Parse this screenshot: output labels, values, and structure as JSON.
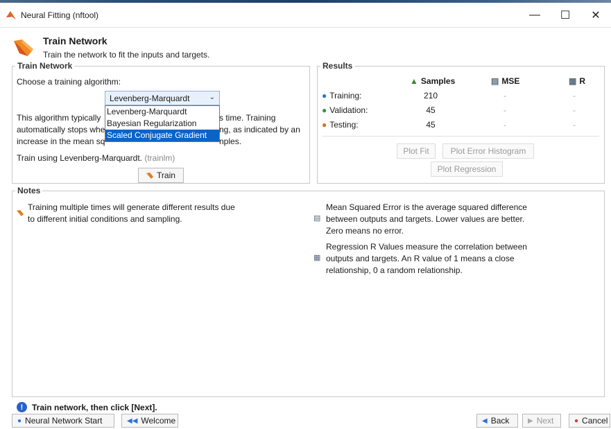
{
  "window": {
    "title": "Neural Fitting (nftool)"
  },
  "header": {
    "title": "Train Network",
    "subtitle": "Train the network to fit the inputs and targets."
  },
  "train": {
    "panel_title": "Train Network",
    "choose_label": "Choose a training algorithm:",
    "selected": "Levenberg-Marquardt",
    "options": [
      "Levenberg-Marquardt",
      "Bayesian Regularization",
      "Scaled Conjugate Gradient"
    ],
    "highlighted_option": "Scaled Conjugate Gradient",
    "desc_line1_left": "This algorithm typically",
    "desc_line1_right": "s time. Training",
    "desc_line2_left": "automatically stops whe",
    "desc_line2_right": "ng, as indicated by an",
    "desc_line3_left": "increase in the mean sq",
    "desc_line3_right": "nples.",
    "train_using": "Train using Levenberg-Marquardt.",
    "train_using_hint": "(trainlm)",
    "train_button": "Train"
  },
  "results": {
    "panel_title": "Results",
    "headers": {
      "samples": "Samples",
      "mse": "MSE",
      "r": "R"
    },
    "rows": [
      {
        "label": "Training:",
        "samples": "210",
        "mse": "-",
        "r": "-"
      },
      {
        "label": "Validation:",
        "samples": "45",
        "mse": "-",
        "r": "-"
      },
      {
        "label": "Testing:",
        "samples": "45",
        "mse": "-",
        "r": "-"
      }
    ],
    "plot_fit": "Plot Fit",
    "plot_error_histogram": "Plot Error Histogram",
    "plot_regression": "Plot Regression"
  },
  "notes": {
    "panel_title": "Notes",
    "note1_line1": "Training multiple times will generate different results due",
    "note1_line2": "to different initial conditions and sampling.",
    "mse_line1": "Mean Squared Error is the average squared difference",
    "mse_line2": "between outputs and targets. Lower values are better.",
    "mse_line3": "Zero means no error.",
    "r_line1": "Regression R Values measure the correlation between",
    "r_line2": "outputs and targets. An R value of 1 means a close",
    "r_line3": "relationship, 0 a random relationship."
  },
  "status": {
    "message": "Train network, then click [Next]."
  },
  "footer": {
    "nn_start": "Neural Network Start",
    "welcome": "Welcome",
    "back": "Back",
    "next": "Next",
    "cancel": "Cancel"
  }
}
